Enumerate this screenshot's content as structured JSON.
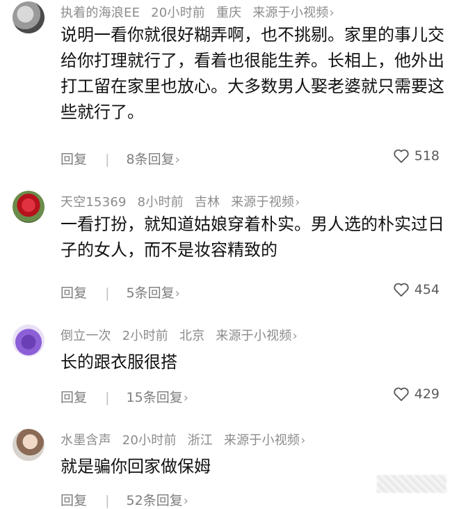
{
  "comments": [
    {
      "username": "执着的海浪EE",
      "time": "20小时前",
      "location": "重庆",
      "source": "来源于小视频",
      "text": "说明一看你就很好糊弄啊，也不挑剔。家里的事儿交给你打理就行了，看着也很能生养。长相上，他外出打工留在家里也放心。大多数男人娶老婆就只需要这些就行了。",
      "reply_label": "回复",
      "replies_label": "8条回复",
      "likes": "518"
    },
    {
      "username": "天空15369",
      "time": "8小时前",
      "location": "吉林",
      "source": "来源于视频",
      "text": "一看打扮，就知道姑娘穿着朴实。男人选的朴实过日子的女人，而不是妆容精致的",
      "reply_label": "回复",
      "replies_label": "5条回复",
      "likes": "454"
    },
    {
      "username": "倒立一次",
      "time": "2小时前",
      "location": "北京",
      "source": "来源于小视频",
      "text": "长的跟衣服很搭",
      "reply_label": "回复",
      "replies_label": "15条回复",
      "likes": "429"
    },
    {
      "username": "水墨含声",
      "time": "20小时前",
      "location": "浙江",
      "source": "来源于小视频",
      "text": "就是骗你回家做保姆",
      "reply_label": "回复",
      "replies_label": "52条回复",
      "likes": ""
    }
  ],
  "icons": {
    "chevron": "chevron-right-icon",
    "like": "heart-icon"
  },
  "colors": {
    "meta_text": "#8b8b8b",
    "body_text": "#111111",
    "action_text": "#7d7d7d"
  }
}
